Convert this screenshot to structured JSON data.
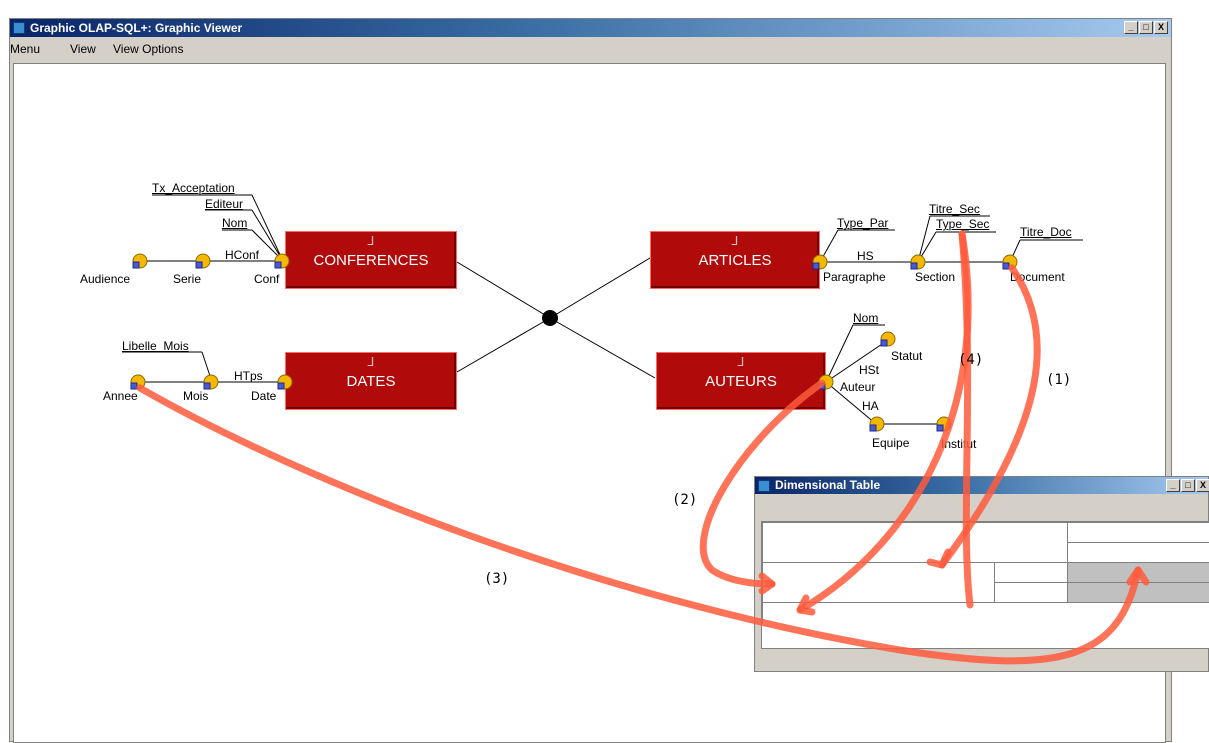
{
  "window": {
    "title": "Graphic OLAP-SQL+: Graphic Viewer",
    "buttons": [
      "_",
      "□",
      "X"
    ]
  },
  "menu": {
    "items": [
      "Menu",
      "View",
      "View Options"
    ]
  },
  "facts": {
    "conferences": "CONFERENCES",
    "dates": "DATES",
    "articles": "ARTICLES",
    "auteurs": "AUTEURS",
    "glyph": "⅃"
  },
  "conf": {
    "tx_acceptation": "Tx_Acceptation",
    "editeur": "Editeur",
    "nom": "Nom",
    "hconf": "HConf",
    "audience": "Audience",
    "serie": "Serie",
    "conf": "Conf"
  },
  "dates": {
    "libelle_mois": "Libelle_Mois",
    "htps": "HTps",
    "annee": "Annee",
    "mois": "Mois",
    "date": "Date"
  },
  "articles": {
    "type_par": "Type_Par",
    "titre_sec": "Titre_Sec",
    "type_sec": "Type_Sec",
    "titre_doc": "Titre_Doc",
    "hs": "HS",
    "paragraphe": "Paragraphe",
    "section": "Section",
    "document": "Document"
  },
  "auteurs": {
    "nom": "Nom",
    "statut": "Statut",
    "hst": "HSt",
    "auteur": "Auteur",
    "ha": "HA",
    "equipe": "Equipe",
    "institut": "Institut"
  },
  "annotations": {
    "a1": "(1)",
    "a2": "(2)",
    "a3": "(3)",
    "a4": "(4)"
  },
  "subwindow": {
    "title": "Dimensional Table"
  },
  "colors": {
    "node": "#f5b800",
    "fact": "#b00a0a",
    "arrow": "#ff5a3c"
  }
}
